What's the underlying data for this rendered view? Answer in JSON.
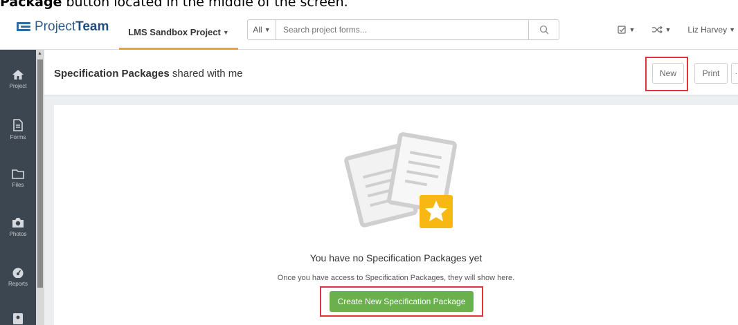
{
  "caption": {
    "bold": "Package",
    "rest": " button located in the middle of the screen."
  },
  "brand": {
    "prefix": "Project",
    "bold": "Team"
  },
  "project": {
    "name": "LMS Sandbox Project"
  },
  "search": {
    "scope": "All",
    "placeholder": "Search project forms..."
  },
  "nav": {
    "user": "Liz Harvey"
  },
  "sidebar": {
    "items": [
      {
        "label": "Project",
        "icon": "home-icon"
      },
      {
        "label": "Forms",
        "icon": "document-icon"
      },
      {
        "label": "Files",
        "icon": "folder-icon"
      },
      {
        "label": "Photos",
        "icon": "camera-icon"
      },
      {
        "label": "Reports",
        "icon": "dashboard-icon"
      },
      {
        "label": "",
        "icon": "contacts-icon"
      }
    ]
  },
  "header": {
    "title_bold": "Specification Packages",
    "title_rest": " shared with me",
    "new_label": "New",
    "print_label": "Print",
    "more_label": "···"
  },
  "empty": {
    "title": "You have no Specification Packages yet",
    "subtitle": "Once you have access to Specification Packages, they will show here.",
    "button": "Create New Specification Package"
  },
  "colors": {
    "accent": "#f0a030",
    "sidebar": "#3c4650",
    "primary_button": "#6ab04c",
    "highlight": "#e0333c",
    "star_badge": "#f7b814"
  }
}
